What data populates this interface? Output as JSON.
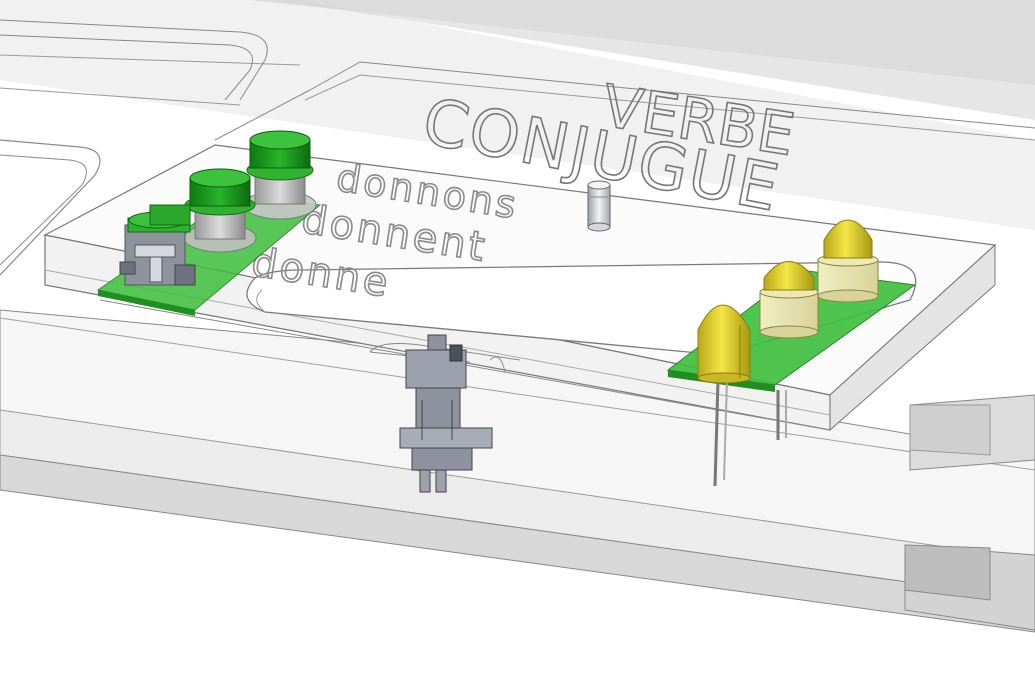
{
  "engraved_title": {
    "line1": "VERBE",
    "line2": "CONJUGUE"
  },
  "engraved_words": [
    "donnons",
    "donnent",
    "donne"
  ],
  "colors": {
    "button_green": "#22aa22",
    "pcb_green": "#33bb33",
    "led_yellow": "#e0d030",
    "switch_gray": "#8a8e9e",
    "background": "#ffffff"
  },
  "components": {
    "left_board": {
      "push_buttons": 3,
      "selector_switch": 1
    },
    "right_board": {
      "leds": 3
    },
    "center": {
      "toggle_switch": 1,
      "indicator_post": 1
    }
  }
}
